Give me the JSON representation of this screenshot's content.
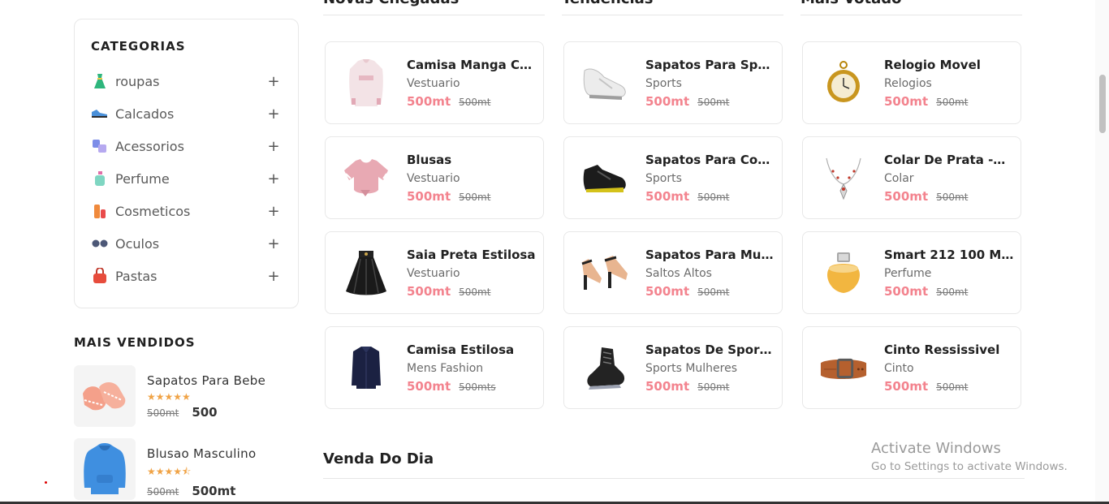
{
  "sidebar": {
    "categories_title": "CATEGORIAS",
    "categories": [
      {
        "label": "roupas",
        "icon": "dress-icon"
      },
      {
        "label": "Calcados",
        "icon": "shoe-icon"
      },
      {
        "label": "Acessorios",
        "icon": "accessories-icon"
      },
      {
        "label": "Perfume",
        "icon": "perfume-icon"
      },
      {
        "label": "Cosmeticos",
        "icon": "cosmetics-icon"
      },
      {
        "label": "Oculos",
        "icon": "glasses-icon"
      },
      {
        "label": "Pastas",
        "icon": "bag-icon"
      }
    ],
    "expand_symbol": "+",
    "best_sellers_title": "MAIS VENDIDOS",
    "best_sellers": [
      {
        "name": "Sapatos Para Bebe",
        "stars": "★★★★★",
        "rating": 5,
        "old_price": "500mt",
        "price": "500"
      },
      {
        "name": "Blusao Masculino",
        "stars": "★★★★⯪",
        "rating": 4.5,
        "old_price": "500mt",
        "price": "500mt"
      }
    ]
  },
  "columns": [
    {
      "heading": "Novas Chegadas",
      "products": [
        {
          "name": "Camisa Manga Co...",
          "category": "Vestuario",
          "price": "500mt",
          "old_price": "500mt",
          "icon": "shirt-icon"
        },
        {
          "name": "Blusas",
          "category": "Vestuario",
          "price": "500mt",
          "old_price": "500mt",
          "icon": "blouse-icon"
        },
        {
          "name": "Saia Preta Estilosa",
          "category": "Vestuario",
          "price": "500mt",
          "old_price": "500mt",
          "icon": "skirt-icon"
        },
        {
          "name": "Camisa Estilosa",
          "category": "Mens Fashion",
          "price": "500mt",
          "old_price": "500mts",
          "icon": "jacket-icon"
        }
      ]
    },
    {
      "heading": "Tendências",
      "products": [
        {
          "name": "Sapatos Para Spor...",
          "category": "Sports",
          "price": "500mt",
          "old_price": "500mt",
          "icon": "sneaker-icon"
        },
        {
          "name": "Sapatos Para Corri...",
          "category": "Sports",
          "price": "500mt",
          "old_price": "500mt",
          "icon": "boot-icon"
        },
        {
          "name": "Sapatos Para Mulh...",
          "category": "Saltos Altos",
          "price": "500mt",
          "old_price": "500mt",
          "icon": "heels-icon"
        },
        {
          "name": "Sapatos De Sport ...",
          "category": "Sports Mulheres",
          "price": "500mt",
          "old_price": "500mt",
          "icon": "high-top-icon"
        }
      ]
    },
    {
      "heading": "Mais Votado",
      "products": [
        {
          "name": "Relogio Movel",
          "category": "Relogios",
          "price": "500mt",
          "old_price": "500mt",
          "icon": "pocket-watch-icon"
        },
        {
          "name": "Colar De Prata -Ci...",
          "category": "Colar",
          "price": "500mt",
          "old_price": "500mt",
          "icon": "necklace-icon"
        },
        {
          "name": "Smart 212 100 Ml P...",
          "category": "Perfume",
          "price": "500mt",
          "old_price": "500mt",
          "icon": "perfume-bottle-icon"
        },
        {
          "name": "Cinto Ressissivel",
          "category": "Cinto",
          "price": "500mt",
          "old_price": "500mt",
          "icon": "belt-icon"
        }
      ]
    }
  ],
  "deal_of_day_title": "Venda Do Dia",
  "activation": {
    "title": "Activate Windows",
    "subtitle": "Go to Settings to activate Windows."
  }
}
